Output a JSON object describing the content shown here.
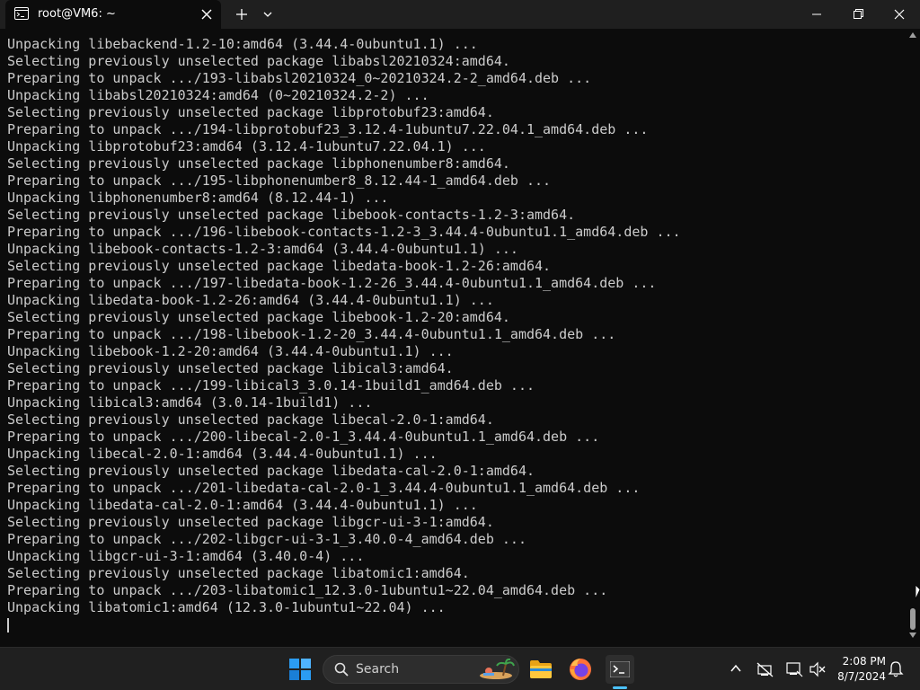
{
  "window": {
    "tab_title": "root@VM6: ~"
  },
  "terminal": {
    "lines": [
      "Unpacking libebackend-1.2-10:amd64 (3.44.4-0ubuntu1.1) ...",
      "Selecting previously unselected package libabsl20210324:amd64.",
      "Preparing to unpack .../193-libabsl20210324_0~20210324.2-2_amd64.deb ...",
      "Unpacking libabsl20210324:amd64 (0~20210324.2-2) ...",
      "Selecting previously unselected package libprotobuf23:amd64.",
      "Preparing to unpack .../194-libprotobuf23_3.12.4-1ubuntu7.22.04.1_amd64.deb ...",
      "Unpacking libprotobuf23:amd64 (3.12.4-1ubuntu7.22.04.1) ...",
      "Selecting previously unselected package libphonenumber8:amd64.",
      "Preparing to unpack .../195-libphonenumber8_8.12.44-1_amd64.deb ...",
      "Unpacking libphonenumber8:amd64 (8.12.44-1) ...",
      "Selecting previously unselected package libebook-contacts-1.2-3:amd64.",
      "Preparing to unpack .../196-libebook-contacts-1.2-3_3.44.4-0ubuntu1.1_amd64.deb ...",
      "Unpacking libebook-contacts-1.2-3:amd64 (3.44.4-0ubuntu1.1) ...",
      "Selecting previously unselected package libedata-book-1.2-26:amd64.",
      "Preparing to unpack .../197-libedata-book-1.2-26_3.44.4-0ubuntu1.1_amd64.deb ...",
      "Unpacking libedata-book-1.2-26:amd64 (3.44.4-0ubuntu1.1) ...",
      "Selecting previously unselected package libebook-1.2-20:amd64.",
      "Preparing to unpack .../198-libebook-1.2-20_3.44.4-0ubuntu1.1_amd64.deb ...",
      "Unpacking libebook-1.2-20:amd64 (3.44.4-0ubuntu1.1) ...",
      "Selecting previously unselected package libical3:amd64.",
      "Preparing to unpack .../199-libical3_3.0.14-1build1_amd64.deb ...",
      "Unpacking libical3:amd64 (3.0.14-1build1) ...",
      "Selecting previously unselected package libecal-2.0-1:amd64.",
      "Preparing to unpack .../200-libecal-2.0-1_3.44.4-0ubuntu1.1_amd64.deb ...",
      "Unpacking libecal-2.0-1:amd64 (3.44.4-0ubuntu1.1) ...",
      "Selecting previously unselected package libedata-cal-2.0-1:amd64.",
      "Preparing to unpack .../201-libedata-cal-2.0-1_3.44.4-0ubuntu1.1_amd64.deb ...",
      "Unpacking libedata-cal-2.0-1:amd64 (3.44.4-0ubuntu1.1) ...",
      "Selecting previously unselected package libgcr-ui-3-1:amd64.",
      "Preparing to unpack .../202-libgcr-ui-3-1_3.40.0-4_amd64.deb ...",
      "Unpacking libgcr-ui-3-1:amd64 (3.40.0-4) ...",
      "Selecting previously unselected package libatomic1:amd64.",
      "Preparing to unpack .../203-libatomic1_12.3.0-1ubuntu1~22.04_amd64.deb ...",
      "Unpacking libatomic1:amd64 (12.3.0-1ubuntu1~22.04) ..."
    ],
    "text_color": "#cccccc",
    "background": "#0c0c0c"
  },
  "taskbar": {
    "search_label": "Search",
    "apps": [
      "windows-start-icon",
      "file-explorer-icon",
      "firefox-icon",
      "terminal-icon"
    ],
    "clock_time": "2:08 PM",
    "clock_date": "8/7/2024",
    "accent": "#4cc2ff"
  }
}
